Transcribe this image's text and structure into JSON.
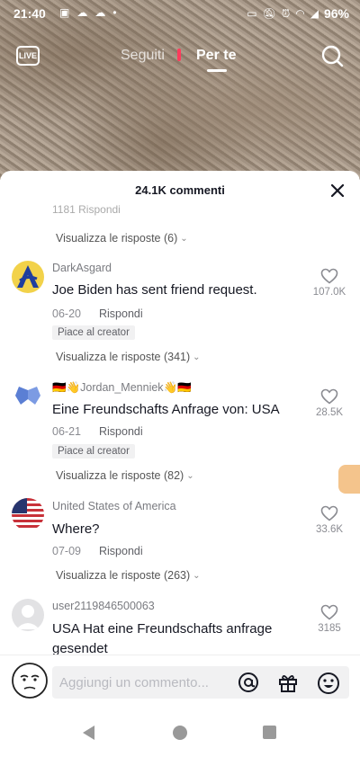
{
  "status_bar": {
    "time": "21:40",
    "battery": "96%"
  },
  "top_nav": {
    "live_label": "LIVE",
    "tab_following": "Seguiti",
    "tab_foryou": "Per te"
  },
  "comments_sheet": {
    "count_label": "24.1K commenti",
    "partial_row": "1181  Rispondi",
    "view_replies_top": "Visualizza le risposte (6)",
    "comments": [
      {
        "username": "DarkAsgard",
        "text": "Joe Biden has sent friend request.",
        "date": "06-20",
        "reply_label": "Rispondi",
        "badge": "Piace al creator",
        "likes": "107.0K",
        "view_replies": "Visualizza le risposte (341)"
      },
      {
        "username": "🇩🇪👋Jordan_Menniek👋🇩🇪",
        "text": "Eine Freundschafts Anfrage von: USA",
        "date": "06-21",
        "reply_label": "Rispondi",
        "badge": "Piace al creator",
        "likes": "28.5K",
        "view_replies": "Visualizza le risposte (82)"
      },
      {
        "username": "United States of America",
        "text": "Where?",
        "date": "07-09",
        "reply_label": "Rispondi",
        "likes": "33.6K",
        "view_replies": "Visualizza le risposte (263)"
      },
      {
        "username": "user2119846500063",
        "text": "USA Hat eine Freundschafts anfrage",
        "text2": "gesendet",
        "likes": "3185"
      }
    ]
  },
  "input_bar": {
    "placeholder": "Aggiungi un commento..."
  },
  "colors": {
    "accent": "#ff3b5c",
    "text": "#161823",
    "muted": "#8a8b91"
  }
}
